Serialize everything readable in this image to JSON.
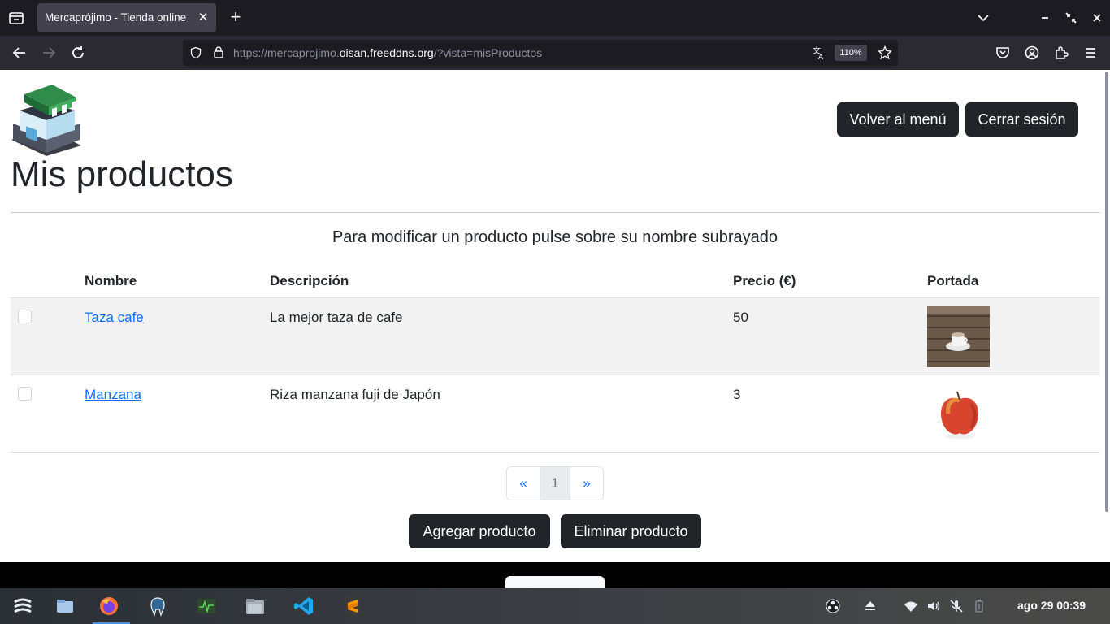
{
  "browser": {
    "tab_title": "Mercaprójimo - Tienda online",
    "url_prefix": "https://mercaprojimo.",
    "url_domain": "oisan.freeddns.org",
    "url_suffix": "/?vista=misProductos",
    "zoom": "110%"
  },
  "header": {
    "back_menu_label": "Volver al menú",
    "logout_label": "Cerrar sesión",
    "title": "Mis productos",
    "hint": "Para modificar un producto pulse sobre su nombre subrayado"
  },
  "table": {
    "columns": [
      "",
      "Nombre",
      "Descripción",
      "Precio (€)",
      "Portada"
    ],
    "rows": [
      {
        "name": "Taza cafe",
        "description": "La mejor taza de cafe",
        "price": "50",
        "image": "coffee-cup-image"
      },
      {
        "name": "Manzana",
        "description": "Riza manzana fuji de Japón",
        "price": "3",
        "image": "apple-image"
      }
    ]
  },
  "pagination": {
    "prev": "«",
    "current": "1",
    "next": "»"
  },
  "actions": {
    "add_label": "Agregar producto",
    "delete_label": "Eliminar producto"
  },
  "taskbar": {
    "clock": "ago 29  00:39"
  },
  "colors": {
    "accent": "#0d6efd",
    "button_dark": "#212529",
    "chrome_dark": "#1c1b22"
  }
}
